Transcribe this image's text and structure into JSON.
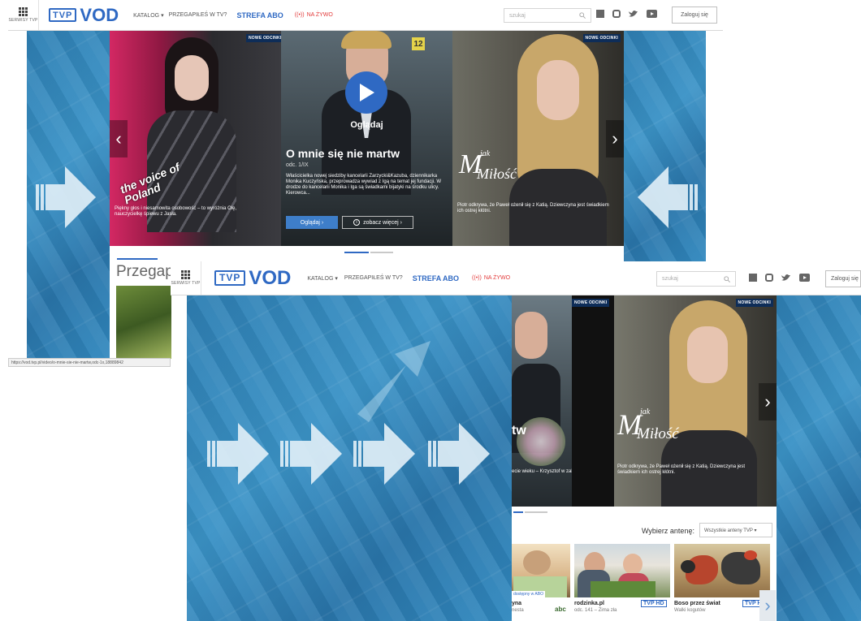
{
  "header": {
    "services_label": "SERWISY TVP",
    "logo_tvp": "TVP",
    "logo_vod": "VOD",
    "nav": {
      "katalog": "KATALOG ▾",
      "przegapiles": "PRZEGAPIŁEŚ W TV?",
      "strefa": "STREFA ABO",
      "live_icon": "((•))",
      "live": "NA ŻYWO"
    },
    "search_placeholder": "szukaj",
    "login_label": "Zaloguj się",
    "login_label_cut": "Zaloguj się"
  },
  "slider_top": {
    "left_slide": {
      "badge": "NOWE ODCINKI",
      "show_logo": "the voice of Poland",
      "caption": "Piękny głos i niesamowita osobowość – to wyróżnia Olę, nauczycielkę śpiewu z Jasła."
    },
    "center_slide": {
      "rating": "12",
      "play_label": "Oglądaj",
      "title": "O mnie się nie martw",
      "episode": "odc. 1/IX",
      "description": "Właścicielka nowej siedziby kancelarii Zarzycki&Kazuba, dziennikarka Monika Kuczyńska, przeprowadza wywiad z Igą na temat jej fundacji. W drodze do kancelarii Monika i Iga są świadkami bijatyki na środku ulicy. Kierowca...",
      "watch_button": "Oglądaj  ›",
      "more_button": "zobacz więcej  ›",
      "info_icon": "i"
    },
    "right_slide": {
      "badge": "NOWE ODCINKI",
      "logo_small": "jak",
      "logo_big": "Miłość",
      "logo_m": "M",
      "caption": "Piotr odkrywa, że Paweł ożenił się z Katią. Dziewczyna jest świadkiem ich ostrej kłótni."
    },
    "section_heading": "Przegapi",
    "status_url": "https://vod.tvp.pl/video/o-mnie-sie-nie-martw,odc-1x,18889842"
  },
  "slider_bottom": {
    "badge_left": "NOWE ODCINKI",
    "badge_right": "NOWE ODCINKI",
    "fragment_title": "tw",
    "fragment_caption": "ecie wieku – Krzysztof w zakładzie",
    "logo_small": "jak",
    "logo_m": "M",
    "logo_big": "Miłość",
    "caption": "Piotr odkrywa, że Paweł ożenił się z Katią. Dziewczyna jest świadkiem ich ostrej kłótni.",
    "antenna_label": "Wybierz antenę:",
    "antenna_select": "Wszystkie anteny TVP ▾",
    "cards": [
      {
        "title": "yna",
        "sub": "nesta",
        "badge": "dostępny w ABO",
        "channel": "abc"
      },
      {
        "title": "rodzinka.pl",
        "sub": "odc. 141 – Zima zła",
        "channel": "TVP HD"
      },
      {
        "title": "Boso przez świat",
        "sub": "Walki kogutów",
        "channel": "TVP HD"
      }
    ]
  },
  "colors": {
    "brand_blue": "#2f69c3",
    "live_red": "#e23a3a",
    "bg_blue": "#3189bf"
  }
}
